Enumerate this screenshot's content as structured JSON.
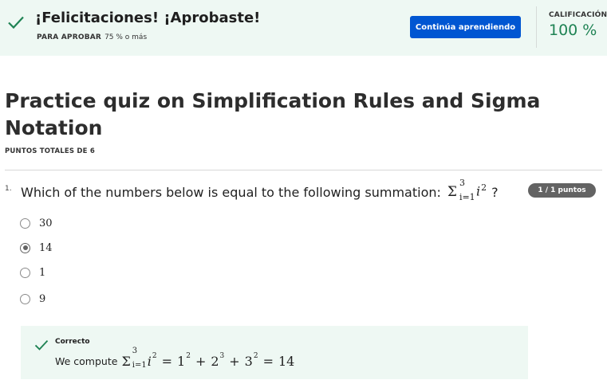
{
  "banner": {
    "title": "¡Felicitaciones! ¡Aprobaste!",
    "pass_label": "PARA APROBAR",
    "pass_value": "75 % o más",
    "continue_label": "Continúa aprendiendo",
    "grade_label": "CALIFICACIÓN",
    "grade_value": "100 %"
  },
  "quiz": {
    "title": "Practice quiz on Simplification Rules and Sigma Notation",
    "total_points": "PUNTOS TOTALES DE 6"
  },
  "question": {
    "number": "1.",
    "text": "Which of the numbers below is equal to the following summation:",
    "math": {
      "sigma": "Σ",
      "upper": "3",
      "lower": "i=1",
      "base": "i",
      "exp": "2"
    },
    "suffix": "?",
    "points": "1 / 1 puntos",
    "options": [
      {
        "label": "30",
        "selected": false
      },
      {
        "label": "14",
        "selected": true
      },
      {
        "label": "1",
        "selected": false
      },
      {
        "label": "9",
        "selected": false
      }
    ]
  },
  "feedback": {
    "status": "Correcto",
    "text": "We compute",
    "math": {
      "sigma": "Σ",
      "upper": "3",
      "lower": "i=1",
      "base": "i",
      "exp": "2",
      "rhs": [
        "1",
        "2",
        "3"
      ],
      "rhs_exp": [
        "2",
        "3",
        "2"
      ],
      "result": "14"
    }
  },
  "colors": {
    "accent": "#0056d2",
    "success": "#1f8354",
    "banner_bg": "#eef8f3",
    "badge": "#636363"
  }
}
